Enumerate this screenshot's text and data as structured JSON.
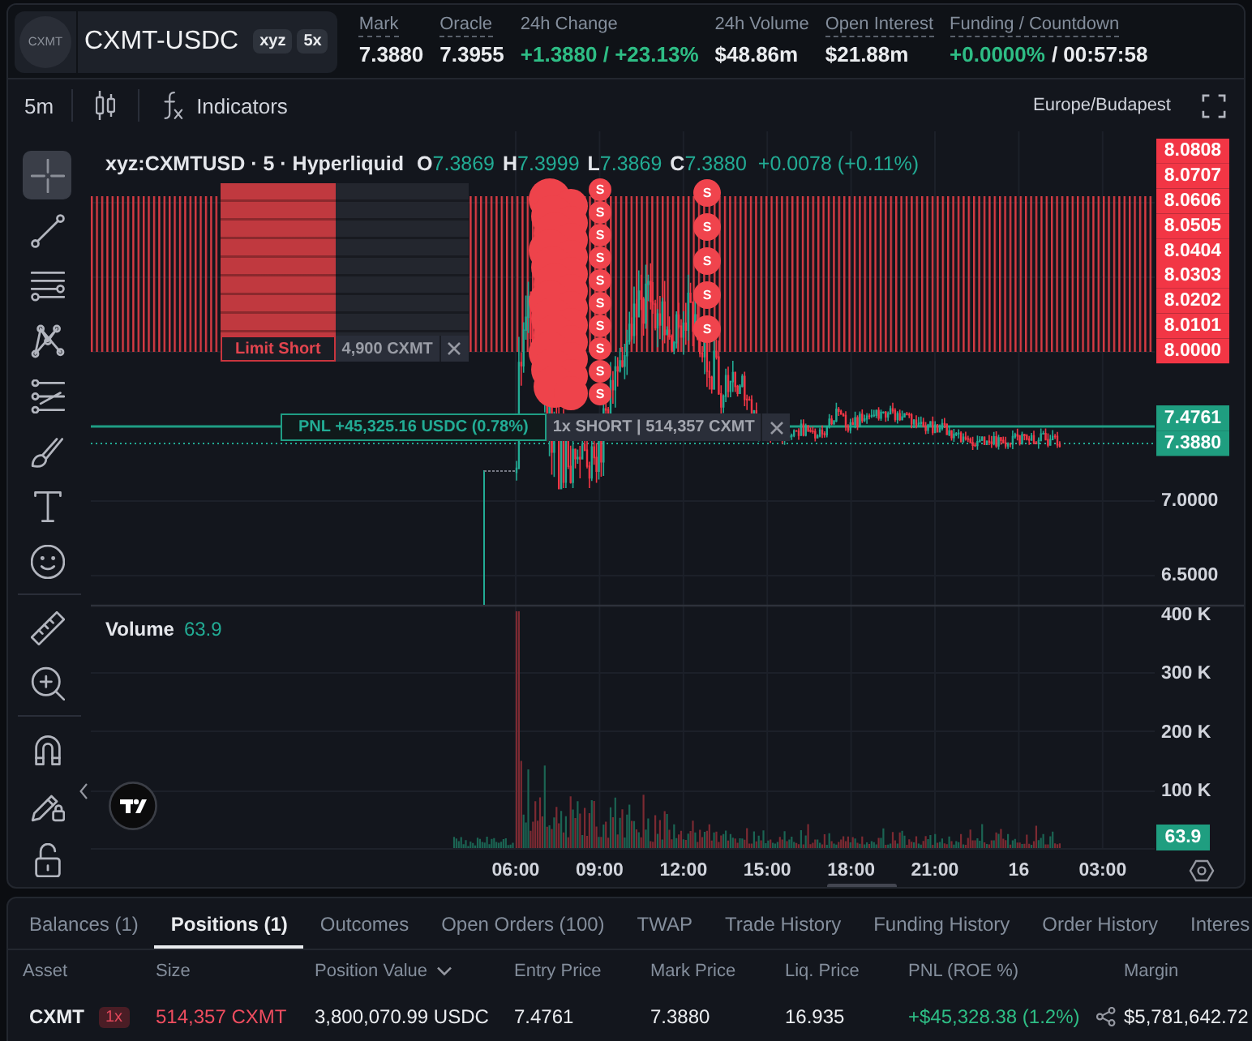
{
  "header": {
    "logo_text": "CXMT",
    "symbol": "CXMT-USDC",
    "badges": [
      "xyz",
      "5x"
    ],
    "stats": [
      {
        "label": "Mark",
        "has_tooltip": true,
        "value": [
          {
            "text": "7.3880",
            "gain": false
          }
        ]
      },
      {
        "label": "Oracle",
        "has_tooltip": true,
        "value": [
          {
            "text": "7.3955",
            "gain": false
          }
        ]
      },
      {
        "label": "24h Change",
        "has_tooltip": false,
        "value": [
          {
            "text": "+1.3880 / +23.13%",
            "gain": true
          }
        ]
      },
      {
        "label": "24h Volume",
        "has_tooltip": false,
        "value": [
          {
            "text": "$48.86m",
            "gain": false
          }
        ]
      },
      {
        "label": "Open Interest",
        "has_tooltip": true,
        "value": [
          {
            "text": "$21.88m",
            "gain": false
          }
        ]
      },
      {
        "label": "Funding / Countdown",
        "has_tooltip": true,
        "value": [
          {
            "text": "+0.0000%",
            "gain": true
          },
          {
            "text": "/ 00:57:58",
            "gain": false
          }
        ]
      }
    ]
  },
  "chart_toolbar": {
    "interval": "5m",
    "indicators": "Indicators",
    "timezone": "Europe/Budapest"
  },
  "drawing_tools": [
    [
      {
        "kind": "crosshair",
        "selected": true
      },
      {
        "kind": "trend-line",
        "selected": false
      },
      {
        "kind": "horizontal-lines",
        "selected": false
      },
      {
        "kind": "pattern",
        "selected": false
      },
      {
        "kind": "fib",
        "selected": false
      },
      {
        "kind": "brush",
        "selected": false
      },
      {
        "kind": "text",
        "selected": false
      },
      {
        "kind": "emoji",
        "selected": false
      }
    ],
    [
      {
        "kind": "ruler",
        "selected": false
      },
      {
        "kind": "zoom-in",
        "selected": false
      }
    ],
    [
      {
        "kind": "magnet",
        "selected": false
      },
      {
        "kind": "lock-drawings",
        "selected": false
      },
      {
        "kind": "lock",
        "selected": false
      }
    ]
  ],
  "chart": {
    "legend": {
      "symbol": "xyz:CXMTUSD · 5 · Hyperliquid",
      "ohlc": [
        {
          "key": "O",
          "value": "7.3869"
        },
        {
          "key": "H",
          "value": "7.3999"
        },
        {
          "key": "L",
          "value": "7.3869"
        },
        {
          "key": "C",
          "value": "7.3880"
        }
      ],
      "change": "+0.0078 (+0.11%)"
    },
    "order_widget": {
      "short": true,
      "label": "Limit Short",
      "quantity": "4,900 CXMT"
    },
    "position_widget": {
      "profit": true,
      "pnl": "PNL +45,325.16 USDC (0.78%)",
      "details": "1x SHORT | 514,357 CXMT"
    },
    "sell_markers": {
      "cluster": [
        {
          "label": "S"
        },
        {
          "label": "S"
        },
        {
          "label": "S"
        },
        {
          "label": "S"
        },
        {
          "label": "S"
        },
        {
          "label": "S"
        },
        {
          "label": "S"
        },
        {
          "label": "S"
        },
        {
          "label": "S"
        },
        {
          "label": "S"
        }
      ],
      "column": [
        {
          "label": "S"
        },
        {
          "label": "S"
        },
        {
          "label": "S"
        },
        {
          "label": "S"
        },
        {
          "label": "S"
        }
      ]
    },
    "price_axis": {
      "order_labels": [
        "8.0808",
        "8.0707",
        "8.0606",
        "8.0505",
        "8.0404",
        "8.0303",
        "8.0202",
        "8.0101",
        "8.0000"
      ],
      "position_labels": [
        "7.4761",
        "7.3880"
      ],
      "ticks": [
        "7.0000",
        "6.5000"
      ]
    },
    "volume": {
      "label": "Volume",
      "value": "63.9",
      "ticks": [
        "400 K",
        "300 K",
        "200 K",
        "100 K"
      ],
      "current": "63.9"
    },
    "time_ticks": [
      "06:00",
      "09:00",
      "12:00",
      "15:00",
      "18:00",
      "21:00",
      "16",
      "03:00"
    ]
  },
  "positions_panel": {
    "tabs": [
      {
        "label": "Balances (1)",
        "selected": false
      },
      {
        "label": "Positions (1)",
        "selected": true
      },
      {
        "label": "Outcomes",
        "selected": false
      },
      {
        "label": "Open Orders (100)",
        "selected": false
      },
      {
        "label": "TWAP",
        "selected": false
      },
      {
        "label": "Trade History",
        "selected": false
      },
      {
        "label": "Funding History",
        "selected": false
      },
      {
        "label": "Order History",
        "selected": false
      },
      {
        "label": "Interes",
        "selected": false
      }
    ],
    "columns": [
      {
        "label": "Asset",
        "has_menu": false
      },
      {
        "label": "Size",
        "has_menu": false
      },
      {
        "label": "Position Value",
        "has_menu": true
      },
      {
        "label": "Entry Price",
        "has_menu": false
      },
      {
        "label": "Mark Price",
        "has_menu": false
      },
      {
        "label": "Liq. Price",
        "has_menu": false
      },
      {
        "label": "PNL (ROE %)",
        "has_menu": false
      },
      {
        "label": "Margin",
        "has_menu": false
      }
    ],
    "rows": [
      {
        "asset": "CXMT",
        "leverage": "1x",
        "short": true,
        "size": "514,357 CXMT",
        "position_value": "3,800,070.99 USDC",
        "entry_price": "7.4761",
        "mark_price": "7.3880",
        "liq_price": "16.935",
        "pnl": "+$45,328.38 (1.2%)",
        "profit": true,
        "margin": "$5,781,642.72"
      }
    ]
  }
}
